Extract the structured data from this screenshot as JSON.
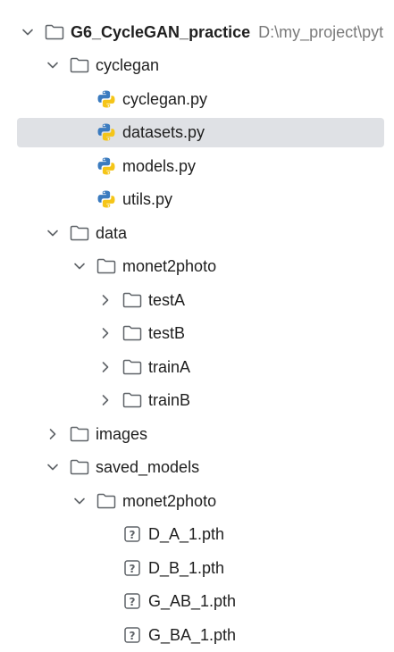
{
  "project_view": {
    "root": {
      "name": "G6_CycleGAN_practice",
      "path": "D:\\my_project\\pyt"
    },
    "nodes": [
      {
        "label": "cyclegan",
        "type": "folder",
        "expanded": true
      },
      {
        "label": "cyclegan.py",
        "type": "python"
      },
      {
        "label": "datasets.py",
        "type": "python",
        "selected": true
      },
      {
        "label": "models.py",
        "type": "python"
      },
      {
        "label": "utils.py",
        "type": "python"
      },
      {
        "label": "data",
        "type": "folder",
        "expanded": true
      },
      {
        "label": "monet2photo",
        "type": "folder",
        "expanded": true
      },
      {
        "label": "testA",
        "type": "folder",
        "expanded": false
      },
      {
        "label": "testB",
        "type": "folder",
        "expanded": false
      },
      {
        "label": "trainA",
        "type": "folder",
        "expanded": false
      },
      {
        "label": "trainB",
        "type": "folder",
        "expanded": false
      },
      {
        "label": "images",
        "type": "folder",
        "expanded": false
      },
      {
        "label": "saved_models",
        "type": "folder",
        "expanded": true
      },
      {
        "label": "monet2photo",
        "type": "folder",
        "expanded": true
      },
      {
        "label": "D_A_1.pth",
        "type": "unknown"
      },
      {
        "label": "D_B_1.pth",
        "type": "unknown"
      },
      {
        "label": "G_AB_1.pth",
        "type": "unknown"
      },
      {
        "label": "G_BA_1.pth",
        "type": "unknown"
      }
    ]
  },
  "icons": {
    "chevron_expanded": "chevron-down-icon",
    "chevron_collapsed": "chevron-right-icon",
    "folder": "folder-icon",
    "python": "python-file-icon",
    "unknown": "unknown-file-icon"
  },
  "colors": {
    "selection": "#dfe1e5",
    "text": "#1f1f1f",
    "path_text": "#7a7a7a",
    "python_blue": "#3b7bbf",
    "python_yellow": "#f5c518",
    "icon_stroke": "#5f6368"
  }
}
